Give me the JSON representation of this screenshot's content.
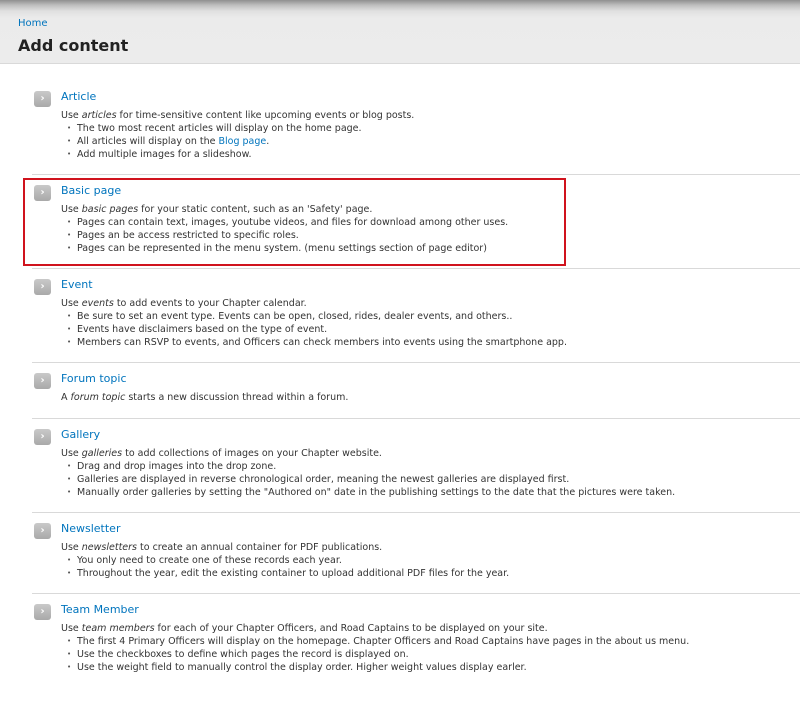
{
  "header": {
    "breadcrumb": "Home",
    "title": "Add content"
  },
  "items": [
    {
      "title": "Article",
      "desc_pre": "Use ",
      "desc_em": "articles",
      "desc_post": " for time-sensitive content like upcoming events or blog posts.",
      "bullets": [
        "The two most recent articles will display on the home page.",
        "All articles will display on the ",
        "Add multiple images for a slideshow."
      ],
      "bullet_link": "Blog page",
      "bullet_link_post": "."
    },
    {
      "title": "Basic page",
      "desc_pre": "Use ",
      "desc_em": "basic pages",
      "desc_post": " for your static content, such as an 'Safety' page.",
      "bullets": [
        "Pages can contain text, images, youtube videos, and files for download among other uses.",
        "Pages an be access restricted to specific roles.",
        "Pages can be represented in the menu system. (menu settings section of page editor)"
      ]
    },
    {
      "title": "Event",
      "desc_pre": "Use ",
      "desc_em": "events",
      "desc_post": " to add events to your Chapter calendar.",
      "bullets": [
        "Be sure to set an event type. Events can be open, closed, rides, dealer events, and others..",
        "Events have disclaimers based on the type of event.",
        "Members can RSVP to events, and Officers can check members into events using the smartphone app."
      ]
    },
    {
      "title": "Forum topic",
      "desc_pre": "A ",
      "desc_em": "forum topic",
      "desc_post": " starts a new discussion thread within a forum.",
      "bullets": []
    },
    {
      "title": "Gallery",
      "desc_pre": "Use ",
      "desc_em": "galleries",
      "desc_post": " to add collections of images on your Chapter website.",
      "bullets": [
        "Drag and drop images into the drop zone.",
        "Galleries are displayed in reverse chronological order, meaning the newest galleries are displayed first.",
        "Manually order galleries by setting the \"Authored on\" date in the publishing settings to the date that the pictures were taken."
      ]
    },
    {
      "title": "Newsletter",
      "desc_pre": "Use ",
      "desc_em": "newsletters",
      "desc_post": " to create an annual container for PDF publications.",
      "bullets": [
        "You only need to create one of these records each year.",
        "Throughout the year, edit the existing container to upload additional PDF files for the year."
      ]
    },
    {
      "title": "Team Member",
      "desc_pre": "Use ",
      "desc_em": "team members",
      "desc_post": " for each of your Chapter Officers, and Road Captains to be displayed on your site.",
      "bullets": [
        "The first 4 Primary Officers will display on the homepage. Chapter Officers and Road Captains have pages in the about us menu.",
        "Use the checkboxes to define which pages the record is displayed on.",
        "Use the weight field to manually control the display order. Higher weight values display earler."
      ]
    }
  ],
  "arrow_glyph": "›",
  "colors": {
    "link": "#0074bd",
    "highlight": "#d0131d"
  }
}
